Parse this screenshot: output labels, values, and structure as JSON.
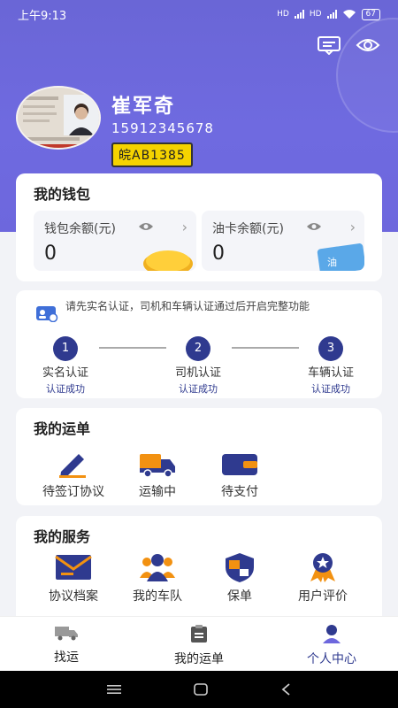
{
  "status_bar": {
    "time": "上午9:13",
    "signal1": "HD",
    "signal2": "HD",
    "battery": "67"
  },
  "profile": {
    "name": "崔军奇",
    "phone": "15912345678",
    "plate": "皖AB1385"
  },
  "wallet": {
    "title": "我的钱包",
    "balance_label": "钱包余额(元)",
    "balance_value": "0",
    "fuel_label": "油卡余额(元)",
    "fuel_value": "0",
    "fuel_card_text": "油"
  },
  "verify": {
    "note": "请先实名认证，司机和车辆认证通过后开启完整功能",
    "steps": [
      {
        "num": "1",
        "name": "实名认证",
        "status": "认证成功"
      },
      {
        "num": "2",
        "name": "司机认证",
        "status": "认证成功"
      },
      {
        "num": "3",
        "name": "车辆认证",
        "status": "认证成功"
      }
    ]
  },
  "orders": {
    "title": "我的运单",
    "items": [
      {
        "label": "待签订协议",
        "icon": "pen-icon"
      },
      {
        "label": "运输中",
        "icon": "truck-icon"
      },
      {
        "label": "待支付",
        "icon": "wallet-icon"
      }
    ]
  },
  "services": {
    "title": "我的服务",
    "items": [
      {
        "label": "协议档案",
        "icon": "envelope-icon"
      },
      {
        "label": "我的车队",
        "icon": "team-icon"
      },
      {
        "label": "保单",
        "icon": "shield-icon"
      },
      {
        "label": "用户评价",
        "icon": "medal-icon"
      }
    ]
  },
  "tabs": [
    {
      "label": "找运",
      "icon": "truck-icon"
    },
    {
      "label": "我的运单",
      "icon": "clipboard-icon"
    },
    {
      "label": "个人中心",
      "icon": "person-icon",
      "active": true
    }
  ],
  "colors": {
    "accent": "#2f3a8f",
    "hero": "#6d67dd",
    "orange": "#f29111",
    "plate": "#f5d300"
  }
}
